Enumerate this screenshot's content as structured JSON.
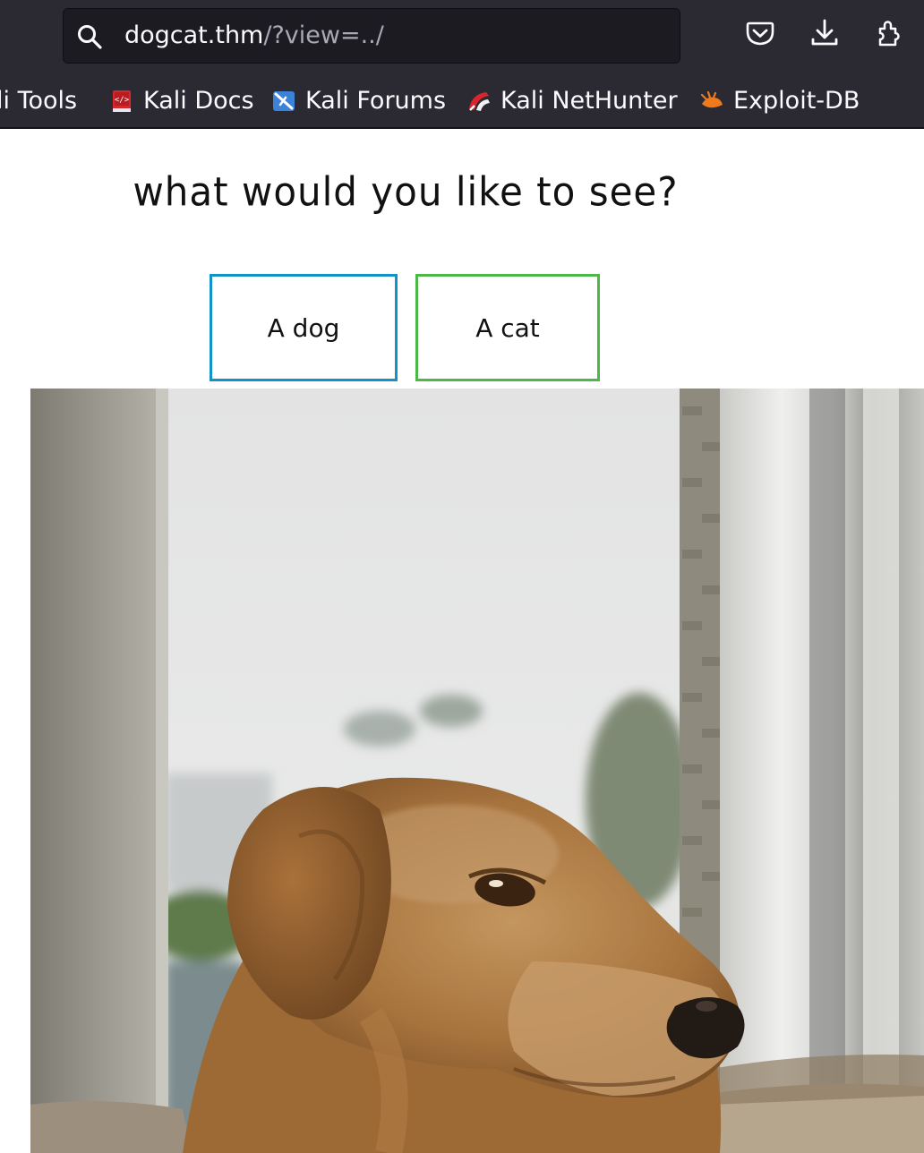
{
  "browser": {
    "url_host": "dogcat.thm",
    "url_path": "/?view=../",
    "toolbar_icons": [
      "search-icon",
      "pocket-icon",
      "download-icon",
      "extensions-icon"
    ]
  },
  "bookmarks": [
    {
      "label": "li Tools",
      "icon": "kali-tools-icon"
    },
    {
      "label": "Kali Docs",
      "icon": "kali-docs-icon"
    },
    {
      "label": "Kali Forums",
      "icon": "kali-forums-icon"
    },
    {
      "label": "Kali NetHunter",
      "icon": "kali-nethunter-icon"
    },
    {
      "label": "Exploit-DB",
      "icon": "exploit-db-icon"
    }
  ],
  "page": {
    "heading": "what would you like to see?",
    "buttons": {
      "dog": "A dog",
      "cat": "A cat"
    },
    "image_subject": "golden retriever"
  },
  "colors": {
    "dog_button_border": "#1192c8",
    "cat_button_border": "#4cb847",
    "toolbar_bg": "#2b2a33",
    "urlbar_bg": "#1c1b22"
  }
}
